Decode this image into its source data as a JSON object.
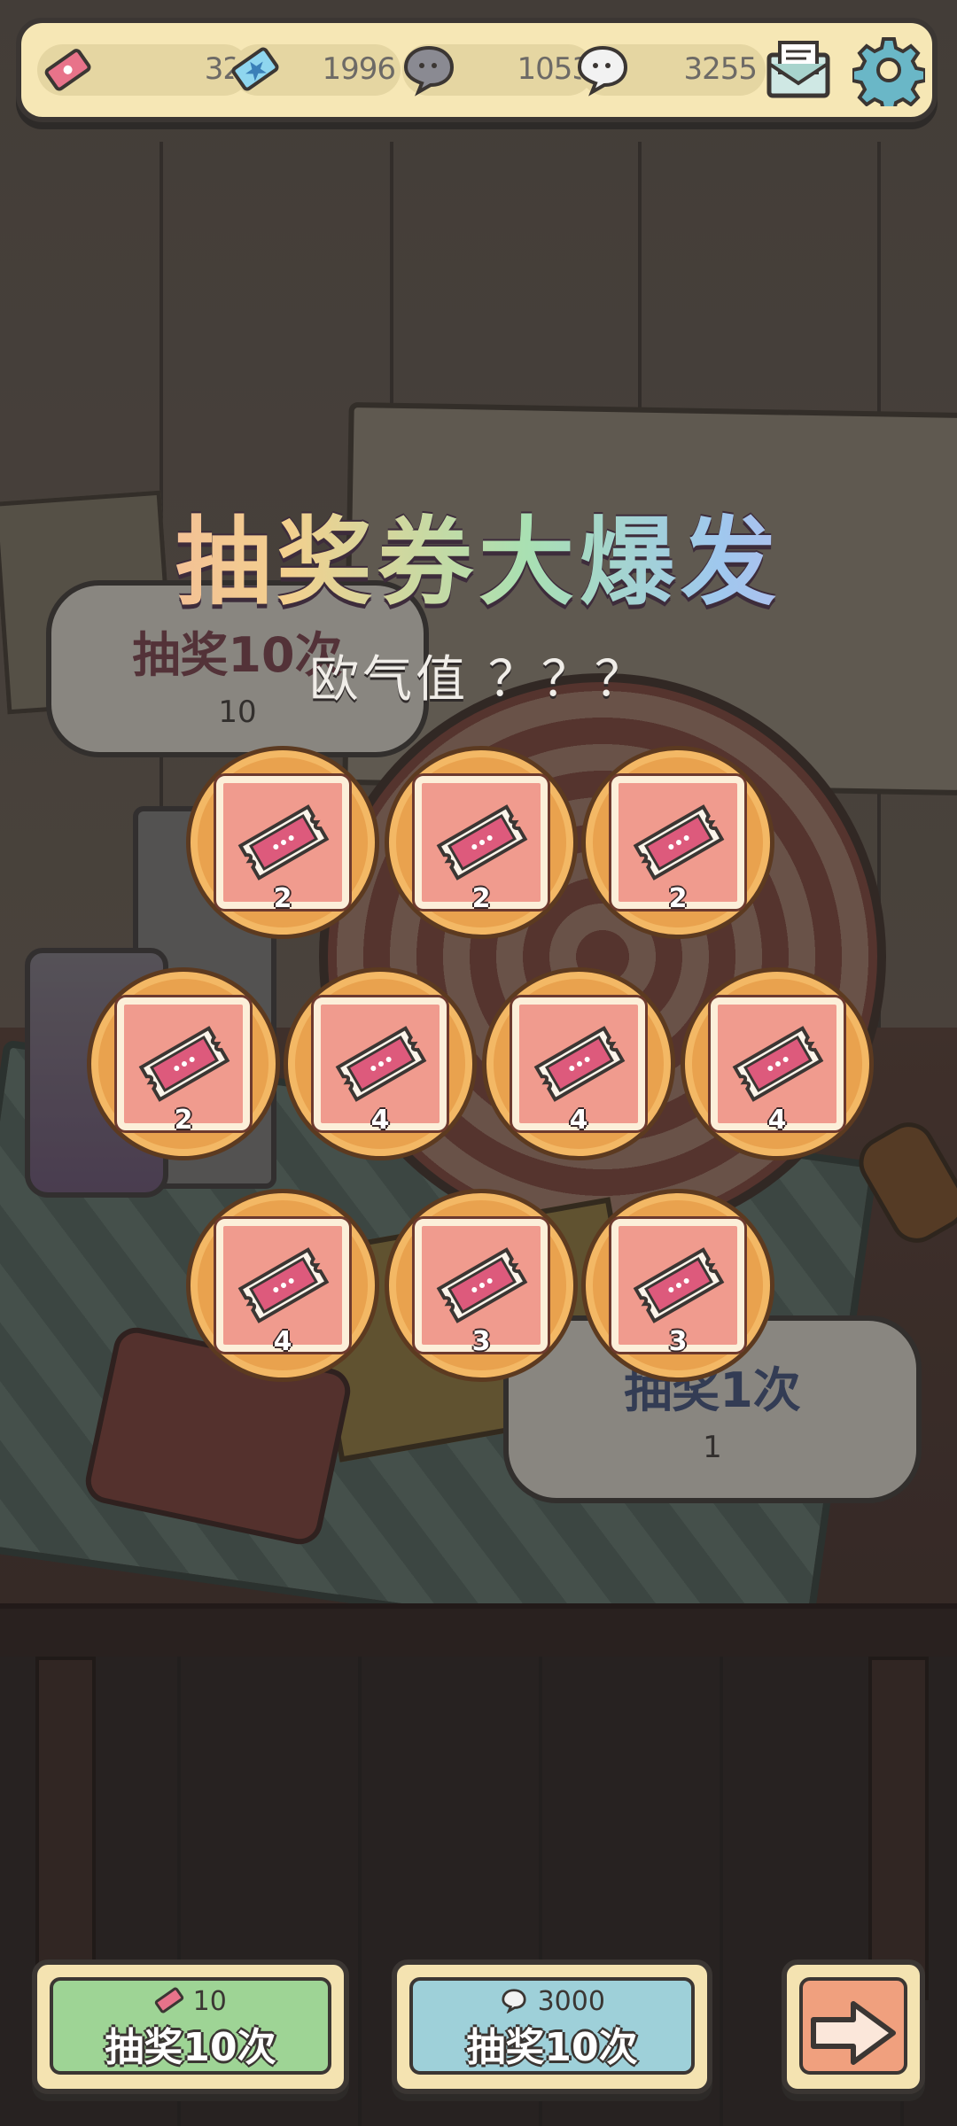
{
  "resources": {
    "tickets": "32",
    "stars": "1996",
    "gray_bubbles": "1053",
    "white_bubbles": "3255"
  },
  "icons": {
    "ticket": "ticket-icon",
    "star_ticket": "star-ticket-icon",
    "gray_bubble": "gray-speech-bubble-icon",
    "white_bubble": "white-speech-bubble-icon",
    "mail": "mail-icon",
    "settings": "gear-icon"
  },
  "title": "抽奖券大爆发",
  "luck_label": "欧气值 ？？？",
  "background_cards": {
    "left": {
      "title": "抽奖10次",
      "cost": "10"
    },
    "right": {
      "title": "抽奖1次",
      "cost": "1"
    }
  },
  "rewards": [
    {
      "item": "lottery-ticket",
      "qty": "2"
    },
    {
      "item": "lottery-ticket",
      "qty": "2"
    },
    {
      "item": "lottery-ticket",
      "qty": "2"
    },
    {
      "item": "lottery-ticket",
      "qty": "2"
    },
    {
      "item": "lottery-ticket",
      "qty": "4"
    },
    {
      "item": "lottery-ticket",
      "qty": "4"
    },
    {
      "item": "lottery-ticket",
      "qty": "4"
    },
    {
      "item": "lottery-ticket",
      "qty": "4"
    },
    {
      "item": "lottery-ticket",
      "qty": "3"
    },
    {
      "item": "lottery-ticket",
      "qty": "3"
    }
  ],
  "buttons": {
    "draw_ticket": {
      "cost": "10",
      "label": "抽奖10次",
      "color": "#9ed495"
    },
    "draw_bubble": {
      "cost": "3000",
      "label": "抽奖10次",
      "color": "#9ed0d9"
    },
    "next": {
      "color": "#f0a07e"
    }
  }
}
